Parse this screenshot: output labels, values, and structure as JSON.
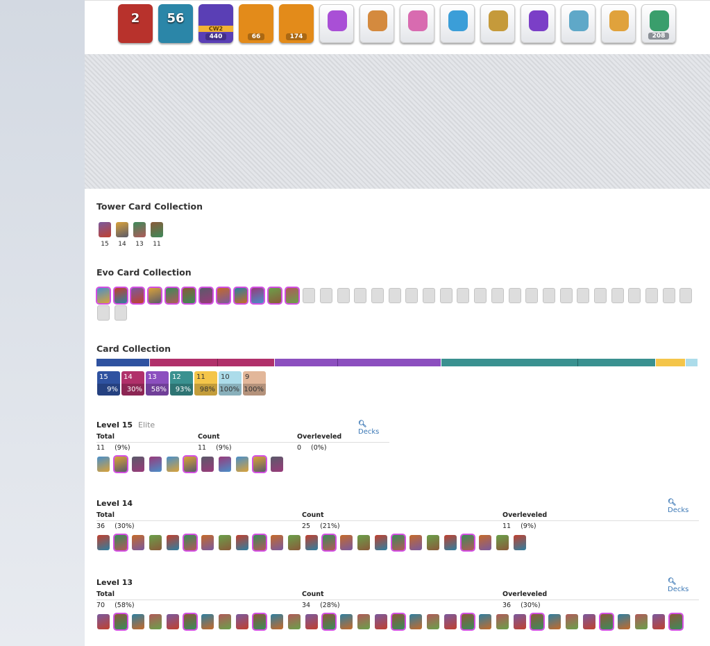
{
  "badges": [
    {
      "label": "2",
      "color": "#b8322c",
      "kind": "big"
    },
    {
      "label": "56",
      "color": "#2b86a8",
      "kind": "big"
    },
    {
      "label": "CW2",
      "value": "440",
      "color": "#5a3fb5",
      "kind": "num"
    },
    {
      "value": "66",
      "color": "#e38b1a",
      "kind": "num"
    },
    {
      "value": "174",
      "color": "#e38b1a",
      "kind": "num"
    },
    {
      "color": "#a94fd6",
      "kind": "medal"
    },
    {
      "color": "#d48a3e",
      "kind": "medal"
    },
    {
      "color": "#d86bb0",
      "kind": "medal"
    },
    {
      "color": "#3b9ed8",
      "kind": "medal"
    },
    {
      "color": "#c59a3b",
      "kind": "medal"
    },
    {
      "color": "#7b3fc7",
      "kind": "medal"
    },
    {
      "color": "#5fa8c8",
      "kind": "medal"
    },
    {
      "color": "#e0a23c",
      "kind": "medal"
    },
    {
      "value": "208",
      "color": "#3a9e6c",
      "kind": "num"
    }
  ],
  "tower": {
    "title": "Tower Card Collection",
    "cards": [
      {
        "level": "15"
      },
      {
        "level": "14"
      },
      {
        "level": "13"
      },
      {
        "level": "11"
      }
    ]
  },
  "evo": {
    "title": "Evo Card Collection",
    "unlocked": 12,
    "locked": 25
  },
  "collection": {
    "title": "Card Collection",
    "levels": [
      {
        "level": "15",
        "pct": "9%",
        "color": "#2f52a0"
      },
      {
        "level": "14",
        "pct": "30%",
        "color": "#b0306a"
      },
      {
        "level": "13",
        "pct": "58%",
        "color": "#8c4fbf"
      },
      {
        "level": "12",
        "pct": "93%",
        "color": "#3a9190"
      },
      {
        "level": "11",
        "pct": "98%",
        "color": "#f4c54a"
      },
      {
        "level": "10",
        "pct": "100%",
        "color": "#acdcea"
      },
      {
        "level": "9",
        "pct": "100%",
        "color": "#e2b79a"
      }
    ]
  },
  "sections": [
    {
      "title": "Level 15",
      "sub": "Elite",
      "decks": "Decks",
      "h_total": "Total",
      "h_count": "Count",
      "h_over": "Overleveled",
      "total": "11",
      "total_pct": "(9%)",
      "count": "11",
      "count_pct": "(9%)",
      "over": "0",
      "over_pct": "(0%)",
      "cards": 11
    },
    {
      "title": "Level 14",
      "sub": "",
      "decks": "Decks",
      "h_total": "Total",
      "h_count": "Count",
      "h_over": "Overleveled",
      "total": "36",
      "total_pct": "(30%)",
      "count": "25",
      "count_pct": "(21%)",
      "over": "11",
      "over_pct": "(9%)",
      "cards": 25
    },
    {
      "title": "Level 13",
      "sub": "",
      "decks": "Decks",
      "h_total": "Total",
      "h_count": "Count",
      "h_over": "Overleveled",
      "total": "70",
      "total_pct": "(58%)",
      "count": "34",
      "count_pct": "(28%)",
      "over": "36",
      "over_pct": "(30%)",
      "cards": 34
    }
  ]
}
